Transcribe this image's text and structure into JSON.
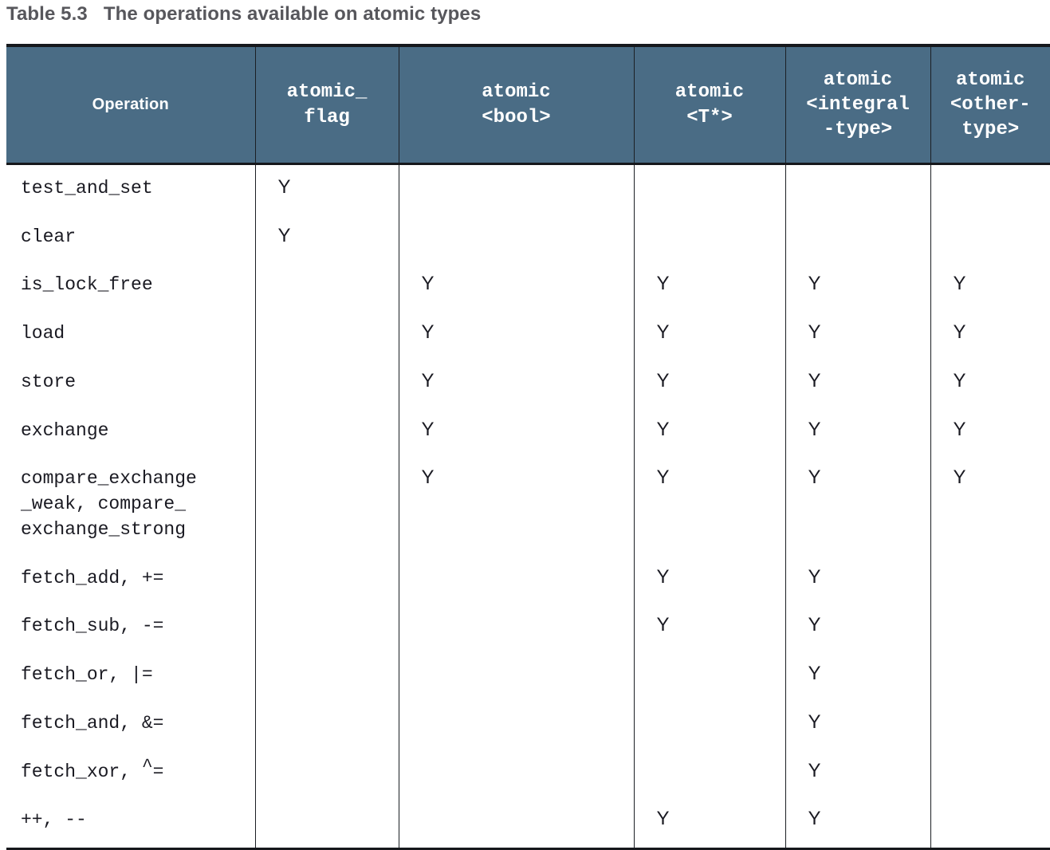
{
  "caption": {
    "number": "Table 5.3",
    "text": "The operations available on atomic types"
  },
  "colors": {
    "header_background": "#4a6c85",
    "header_text": "#ffffff",
    "caption_text": "#57575c",
    "rule": "#16181c",
    "body_text": "#1a1a22"
  },
  "table": {
    "columns": [
      {
        "id": "operation",
        "label": "Operation",
        "style": "sans-bold"
      },
      {
        "id": "atomic_flag",
        "label": "atomic_\nflag",
        "style": "mono"
      },
      {
        "id": "atomic_bool",
        "label": "atomic\n<bool>",
        "style": "mono"
      },
      {
        "id": "atomic_tptr",
        "label": "atomic\n<T*>",
        "style": "mono"
      },
      {
        "id": "atomic_intgrl",
        "label": "atomic\n<integral\n-type>",
        "style": "mono"
      },
      {
        "id": "atomic_other",
        "label": "atomic\n<other-\ntype>",
        "style": "mono"
      }
    ],
    "mark": "Y",
    "rows": [
      {
        "operation": "test_and_set",
        "marks": [
          "Y",
          "",
          "",
          "",
          ""
        ]
      },
      {
        "operation": "clear",
        "marks": [
          "Y",
          "",
          "",
          "",
          ""
        ]
      },
      {
        "operation": "is_lock_free",
        "marks": [
          "",
          "Y",
          "Y",
          "Y",
          "Y"
        ]
      },
      {
        "operation": "load",
        "marks": [
          "",
          "Y",
          "Y",
          "Y",
          "Y"
        ]
      },
      {
        "operation": "store",
        "marks": [
          "",
          "Y",
          "Y",
          "Y",
          "Y"
        ]
      },
      {
        "operation": "exchange",
        "marks": [
          "",
          "Y",
          "Y",
          "Y",
          "Y"
        ]
      },
      {
        "operation": "compare_exchange\n_weak, compare_\nexchange_strong",
        "marks": [
          "",
          "Y",
          "Y",
          "Y",
          "Y"
        ]
      },
      {
        "operation": "fetch_add, +=",
        "marks": [
          "",
          "",
          "Y",
          "Y",
          ""
        ]
      },
      {
        "operation": "fetch_sub, -=",
        "marks": [
          "",
          "",
          "Y",
          "Y",
          ""
        ]
      },
      {
        "operation": "fetch_or, |=",
        "marks": [
          "",
          "",
          "",
          "Y",
          ""
        ]
      },
      {
        "operation": "fetch_and, &=",
        "marks": [
          "",
          "",
          "",
          "Y",
          ""
        ]
      },
      {
        "operation": "fetch_xor, ^=",
        "marks": [
          "",
          "",
          "",
          "Y",
          ""
        ]
      },
      {
        "operation": "++, --",
        "marks": [
          "",
          "",
          "Y",
          "Y",
          ""
        ]
      }
    ]
  }
}
